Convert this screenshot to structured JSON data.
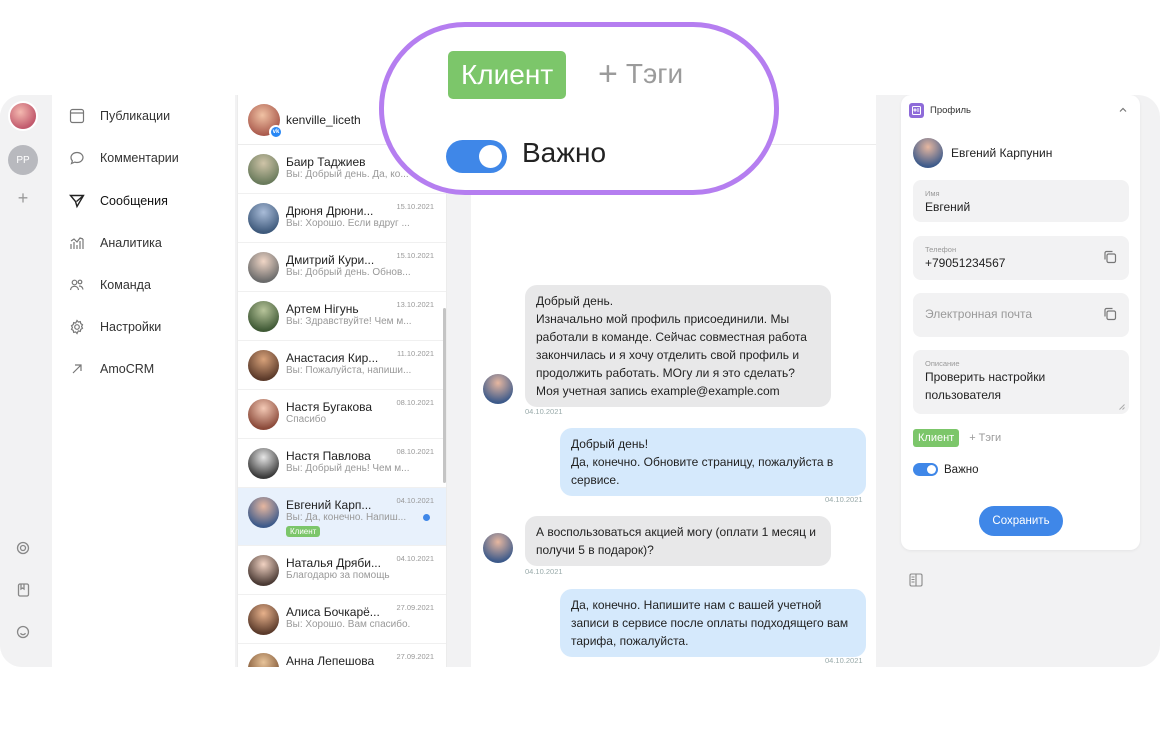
{
  "nav": {
    "items": [
      {
        "label": "Публикации",
        "icon": "publications-icon"
      },
      {
        "label": "Комментарии",
        "icon": "comment-icon"
      },
      {
        "label": "Сообщения",
        "icon": "send-icon"
      },
      {
        "label": "Аналитика",
        "icon": "analytics-icon"
      },
      {
        "label": "Команда",
        "icon": "team-icon"
      },
      {
        "label": "Настройки",
        "icon": "gear-icon"
      },
      {
        "label": "AmoCRM",
        "icon": "arrow-icon"
      }
    ]
  },
  "rail": {
    "initials": "PP"
  },
  "list": {
    "account": "kenville_liceth",
    "conversations": [
      {
        "name": "Баир Таджиев",
        "date": "",
        "preview": "Вы: Добрый день. Да, ко..."
      },
      {
        "name": "Дрюня Дрюни...",
        "date": "15.10.2021",
        "preview": "Вы: Хорошо. Если вдруг ..."
      },
      {
        "name": "Дмитрий Кури...",
        "date": "15.10.2021",
        "preview": "Вы: Добрый день. Обнов..."
      },
      {
        "name": "Артем Нігунь",
        "date": "13.10.2021",
        "preview": "Вы: Здравствуйте! Чем м..."
      },
      {
        "name": "Анастасия Кир...",
        "date": "11.10.2021",
        "preview": "Вы: Пожалуйста, напиши..."
      },
      {
        "name": "Настя Бугакова",
        "date": "08.10.2021",
        "preview": "Спасибо"
      },
      {
        "name": "Настя Павлова",
        "date": "08.10.2021",
        "preview": "Вы: Добрый день! Чем м..."
      },
      {
        "name": "Евгений Карп...",
        "date": "04.10.2021",
        "preview": "Вы: Да, конечно. Напиш...",
        "tag": "Клиент"
      },
      {
        "name": "Наталья Дряби...",
        "date": "04.10.2021",
        "preview": "Благодарю за помощь"
      },
      {
        "name": "Алиса Бочкарё...",
        "date": "27.09.2021",
        "preview": "Вы: Хорошо. Вам спасибо."
      },
      {
        "name": "Анна Лепешова",
        "date": "27.09.2021",
        "preview": ""
      }
    ]
  },
  "chat": {
    "messages": [
      {
        "dir": "in",
        "text": "Добрый день.\nИзначально мой профиль присоединили. Мы работали в команде. Сейчас совместная работа закончилась и я хочу отделить свой профиль и продолжить работать. МОгу ли я это сделать?\nМоя учетная запись example@example.com",
        "date": "04.10.2021"
      },
      {
        "dir": "out",
        "text": "Добрый день!\nДа, конечно. Обновите страницу, пожалуйста в сервисе.",
        "date": "04.10.2021"
      },
      {
        "dir": "in",
        "text": "А воспользоваться акцией могу (оплати 1 месяц и получи 5 в подарок)?",
        "date": "04.10.2021"
      },
      {
        "dir": "out",
        "text": "Да, конечно. Напишите нам с вашей учетной записи в сервисе после оплаты подходящего вам тарифа, пожалуйста.",
        "date": "04.10.2021"
      }
    ]
  },
  "profile": {
    "title": "Профиль",
    "user_name": "Евгений Карпунин",
    "name_label": "Имя",
    "name_value": "Евгений",
    "phone_label": "Телефон",
    "phone_value": "+79051234567",
    "email_placeholder": "Электронная почта",
    "desc_label": "Описание",
    "desc_value": "Проверить настройки пользователя",
    "tag": "Клиент",
    "add_tag": "+ Тэги",
    "important_label": "Важно",
    "save_label": "Сохранить"
  },
  "callout": {
    "tag": "Клиент",
    "add_tag": "Тэги",
    "important_label": "Важно"
  },
  "colors": {
    "accent": "#3f87e8",
    "tag_green": "#7cc66a",
    "callout_border": "#b57ef0",
    "bubble_in": "#e8e8e9",
    "bubble_out": "#d5e9fc"
  }
}
